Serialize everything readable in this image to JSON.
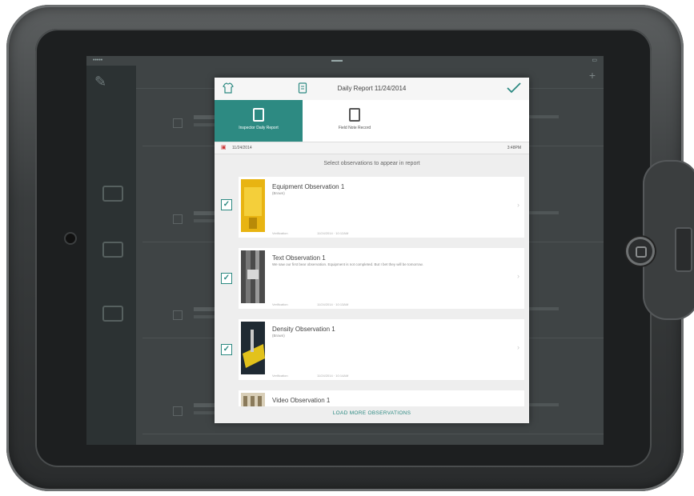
{
  "header": {
    "title": "Daily Report 11/24/2014",
    "left_icon": "shirt-icon",
    "center_icon": "doc-icon",
    "right_icon": "checkmark-icon"
  },
  "tabs": [
    {
      "label": "Inspector Daily Report",
      "active": true
    },
    {
      "label": "Field Note Record",
      "active": false
    }
  ],
  "date_row": {
    "date": "11/24/2014",
    "time": "3:48PM"
  },
  "instructions": "Select observations to appear in report",
  "observations": [
    {
      "title": "Equipment Observation 1",
      "subtitle": "(Brown)",
      "meta_left": "Verification",
      "meta_right": "11/24/2014 · 10:12AM",
      "checked": true
    },
    {
      "title": "Text Observation 1",
      "subtitle": "We saw our first bear observation. Equipment is not completed. But I bet they will be tomorrow.",
      "meta_left": "Verification",
      "meta_right": "11/24/2014 · 10:13AM",
      "checked": true
    },
    {
      "title": "Density Observation 1",
      "subtitle": "(Brown)",
      "meta_left": "Verification",
      "meta_right": "11/24/2014 · 10:14AM",
      "checked": true
    },
    {
      "title": "Video Observation 1"
    }
  ],
  "load_more": "LOAD MORE OBSERVATIONS",
  "colors": {
    "accent": "#2d8a82",
    "case": "#3a3d3e"
  }
}
